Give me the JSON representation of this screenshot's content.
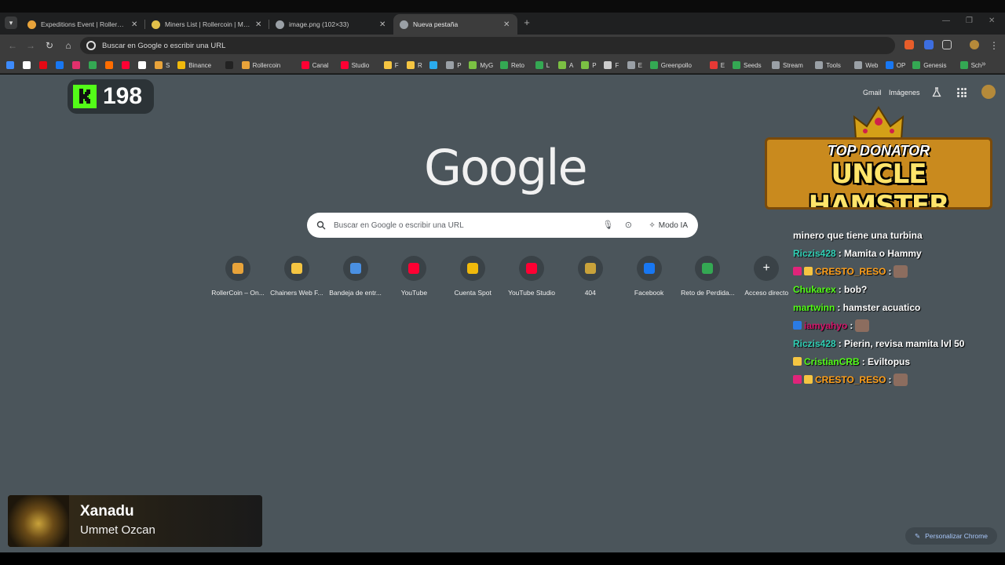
{
  "tabs": [
    {
      "label": "Expeditions Event | RollerCoin",
      "favicon_color": "#e8a33a",
      "active": false
    },
    {
      "label": "Miners List | Rollercoin | Minar",
      "favicon_color": "#e2c04a",
      "active": false
    },
    {
      "label": "image.png (102×33)",
      "favicon_color": "#9aa0a6",
      "active": false
    },
    {
      "label": "Nueva pestaña",
      "favicon_color": "#9aa0a6",
      "active": true
    }
  ],
  "omnibox": {
    "text": "Buscar en Google o escribir una URL"
  },
  "bookmarks": [
    {
      "label": "",
      "color": "#3d8bfd"
    },
    {
      "label": "",
      "color": "#ffffff"
    },
    {
      "label": "",
      "color": "#e50914"
    },
    {
      "label": "",
      "color": "#1877f2"
    },
    {
      "label": "",
      "color": "#e1306c"
    },
    {
      "label": "",
      "color": "#34a853"
    },
    {
      "label": "",
      "color": "#ff6d00"
    },
    {
      "label": "",
      "color": "#ff0033"
    },
    {
      "label": "",
      "color": "#ffffff"
    },
    {
      "label": "S",
      "color": "#e8a33a"
    },
    {
      "label": "Binance",
      "color": "#f0b90b"
    },
    {
      "label": "",
      "color": "#222222"
    },
    {
      "label": "Rollercoin",
      "color": "#e8a33a"
    },
    {
      "label": "Canal",
      "color": "#ff0033"
    },
    {
      "label": "Studio",
      "color": "#ff0033"
    },
    {
      "label": "F",
      "color": "#f5c542"
    },
    {
      "label": "R",
      "color": "#f5c542"
    },
    {
      "label": "",
      "color": "#2aabee"
    },
    {
      "label": "P",
      "color": "#9aa0a6"
    },
    {
      "label": "MyG",
      "color": "#7bc043"
    },
    {
      "label": "Reto",
      "color": "#34a853"
    },
    {
      "label": "L",
      "color": "#34a853"
    },
    {
      "label": "A",
      "color": "#7bc043"
    },
    {
      "label": "P",
      "color": "#7bc043"
    },
    {
      "label": "F",
      "color": "#cccccc"
    },
    {
      "label": "E",
      "color": "#9aa0a6"
    },
    {
      "label": "Greenpollo",
      "color": "#34a853"
    },
    {
      "label": "E",
      "color": "#e53935"
    },
    {
      "label": "Seeds",
      "color": "#34a853"
    },
    {
      "label": "Stream",
      "color": "#9aa0a6"
    },
    {
      "label": "Tools",
      "color": "#9aa0a6"
    },
    {
      "label": "Web",
      "color": "#9aa0a6"
    },
    {
      "label": "OP",
      "color": "#1877f2"
    },
    {
      "label": "Genesis",
      "color": "#34a853"
    },
    {
      "label": "Sch",
      "color": "#34a853"
    }
  ],
  "header_links": {
    "gmail": "Gmail",
    "images": "Imágenes"
  },
  "kick": {
    "count": "198",
    "color": "#53fc18"
  },
  "google": {
    "logo": "Google"
  },
  "search": {
    "placeholder": "Buscar en Google o escribir una URL",
    "ai_mode": "Modo IA"
  },
  "shortcuts": [
    {
      "label": "RollerCoin – On...",
      "color": "#e8a33a"
    },
    {
      "label": "Chainers Web F...",
      "color": "#f5c542"
    },
    {
      "label": "Bandeja de entr...",
      "color": "#4a90e2"
    },
    {
      "label": "YouTube",
      "color": "#ff0033"
    },
    {
      "label": "Cuenta Spot",
      "color": "#f0b90b"
    },
    {
      "label": "YouTube Studio",
      "color": "#ff0033"
    },
    {
      "label": "404",
      "color": "#c9a23a"
    },
    {
      "label": "Facebook",
      "color": "#1877f2"
    },
    {
      "label": "Reto de Perdida...",
      "color": "#34a853"
    },
    {
      "label": "Acceso directo",
      "color": "#ffffff"
    }
  ],
  "donator": {
    "heading": "TOP DONATOR",
    "name": "UNCLE HAMSTER"
  },
  "chat": [
    {
      "user": "",
      "user_color": "#ffffff",
      "message": "minero que tiene una turbina",
      "badges": []
    },
    {
      "user": "Riczis428",
      "user_color": "#2fd0b5",
      "message": ": Mamita o Hammy",
      "badges": []
    },
    {
      "user": "CRESTO_RESO",
      "user_color": "#ff9f1a",
      "message": ":",
      "badges": [
        "#e0247a",
        "#f5c542"
      ],
      "emote": true
    },
    {
      "user": "Chukarex",
      "user_color": "#53fc18",
      "message": ": bob?",
      "badges": []
    },
    {
      "user": "martwinn",
      "user_color": "#53fc18",
      "message": ": hamster acuatico",
      "badges": []
    },
    {
      "user": "iamyahyo",
      "user_color": "#d4146a",
      "message": ":",
      "badges": [
        "#2a7be4"
      ],
      "emote": true
    },
    {
      "user": "Riczis428",
      "user_color": "#2fd0b5",
      "message": ": Pierin, revisa mamita lvl 50",
      "badges": []
    },
    {
      "user": "CristianCRB",
      "user_color": "#53fc18",
      "message": ": Eviltopus",
      "badges": [
        "#f5c542"
      ]
    },
    {
      "user": "CRESTO_RESO",
      "user_color": "#ff9f1a",
      "message": ":",
      "badges": [
        "#e0247a",
        "#f5c542"
      ],
      "emote": true
    }
  ],
  "now_playing": {
    "title": "Xanadu",
    "artist": "Ummet Ozcan"
  },
  "customize": {
    "label": "Personalizar Chrome"
  }
}
